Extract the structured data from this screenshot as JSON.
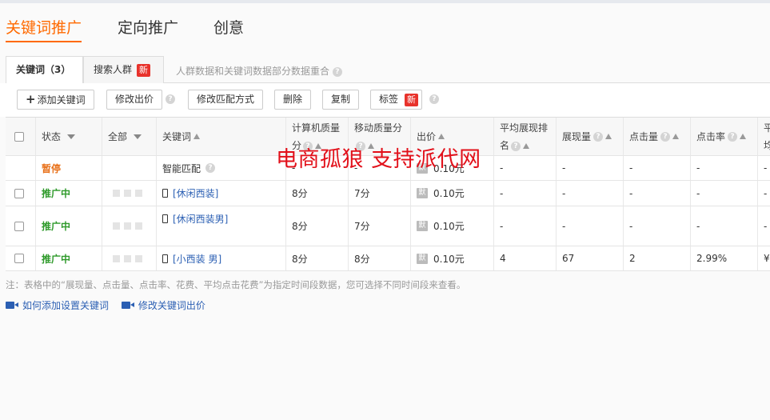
{
  "main_tabs": [
    {
      "label": "关键词推广",
      "active": true
    },
    {
      "label": "定向推广",
      "active": false
    },
    {
      "label": "创意",
      "active": false
    }
  ],
  "sub_tabs": [
    {
      "label": "关键词（3）",
      "active": true
    },
    {
      "label": "搜索人群",
      "badge": "新",
      "active": false
    }
  ],
  "sub_note": "人群数据和关键词数据部分数据重合",
  "toolbar": {
    "add_keyword": "添加关键词",
    "modify_bid": "修改出价",
    "modify_match": "修改匹配方式",
    "delete": "删除",
    "copy": "复制",
    "tag": "标签",
    "tag_badge": "新"
  },
  "table": {
    "headers": {
      "status": "状态",
      "all": "全部",
      "keyword": "关键词",
      "pc_quality": "计算机质量分",
      "mobile_quality": "移动质量分",
      "bid": "出价",
      "avg_rank": "平均展现排名",
      "impressions": "展现量",
      "clicks": "点击量",
      "ctr": "点击率",
      "cost": "平均点击花费"
    },
    "rows": [
      {
        "status": "暂停",
        "status_type": "paused",
        "keyword": "智能匹配",
        "pc_quality": "-",
        "mobile_quality": "-",
        "bid": "0.10元",
        "avg_rank": "-",
        "impressions": "-",
        "clicks": "-",
        "ctr": "-",
        "cost": "-"
      },
      {
        "status": "推广中",
        "status_type": "active",
        "keyword": "[休闲西装]",
        "pc_quality": "8分",
        "mobile_quality": "7分",
        "bid": "0.10元",
        "avg_rank": "-",
        "impressions": "-",
        "clicks": "-",
        "ctr": "-",
        "cost": "-"
      },
      {
        "status": "推广中",
        "status_type": "active",
        "keyword": "[休闲西装男]",
        "pc_quality": "8分",
        "mobile_quality": "7分",
        "bid": "0.10元",
        "avg_rank": "-",
        "impressions": "-",
        "clicks": "-",
        "ctr": "-",
        "cost": "-"
      },
      {
        "status": "推广中",
        "status_type": "active",
        "keyword": "[小西装 男]",
        "pc_quality": "8分",
        "mobile_quality": "8分",
        "bid": "0.10元",
        "avg_rank": "4",
        "impressions": "67",
        "clicks": "2",
        "ctr": "2.99%",
        "cost": "¥"
      }
    ]
  },
  "footnote": "注：表格中的“展现量、点击量、点击率、花费、平均点击花费”为指定时间段数据，您可选择不同时间段来查看。",
  "help_links": [
    "如何添加设置关键词",
    "修改关键词出价"
  ],
  "watermark": "电商孤狼 支持派代网",
  "colors": {
    "accent": "#ff6a00",
    "active_status": "#2f9a2b",
    "paused_status": "#e8711a",
    "link": "#2b5fb3",
    "badge": "#e8322b"
  }
}
